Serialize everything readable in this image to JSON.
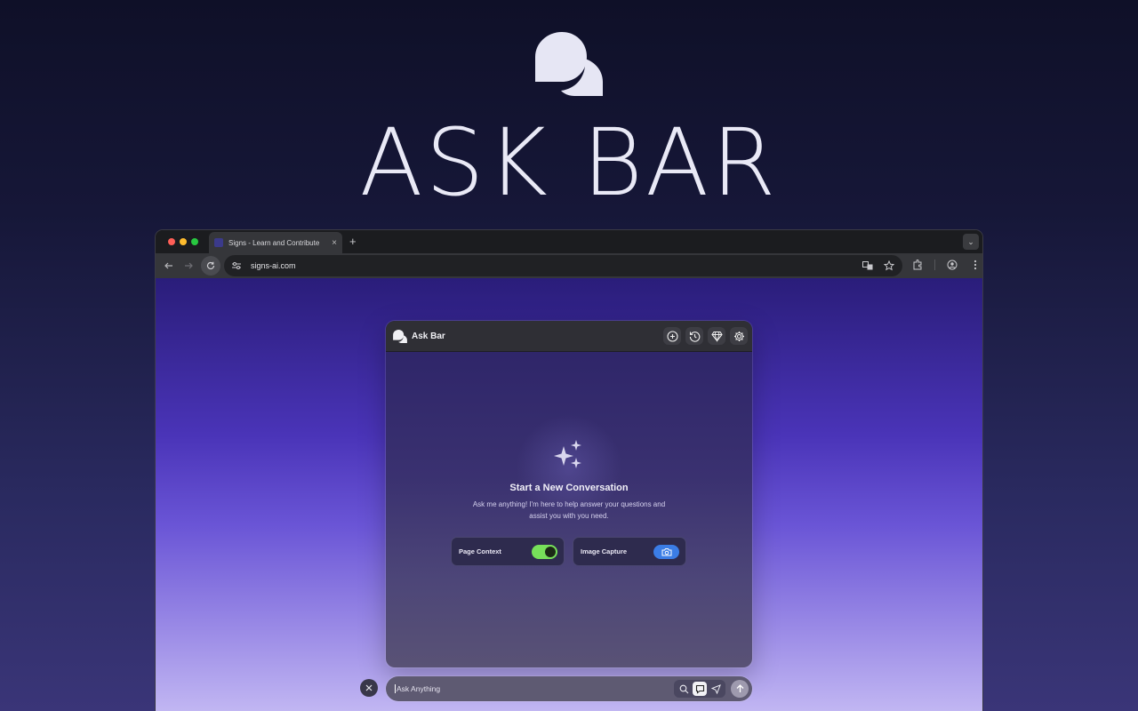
{
  "hero": {
    "title": "ASK BAR",
    "logo_icon": "chat-bubbles-icon"
  },
  "browser": {
    "tab": {
      "title": "Signs - Learn and Contribute",
      "close": "×"
    },
    "new_tab": "+",
    "url": "signs-ai.com"
  },
  "panel": {
    "title": "Ask Bar",
    "actions": [
      "plus-circle-icon",
      "history-icon",
      "gem-icon",
      "settings-icon"
    ],
    "empty_state": {
      "heading": "Start a New Conversation",
      "description": "Ask me anything! I'm here to help answer your questions and assist you with you need."
    },
    "cards": {
      "page_context": {
        "label": "Page Context",
        "enabled": true
      },
      "image_capture": {
        "label": "Image Capture"
      }
    }
  },
  "ask_input": {
    "placeholder": "Ask Anything",
    "modes": [
      "search-icon",
      "chat-icon",
      "send-arrow-icon"
    ],
    "active_mode": "chat-icon"
  },
  "colors": {
    "toggle_on": "#77e05a",
    "camera_button": "#3b7de6",
    "page_gradient_top": "#2a1d7a",
    "page_gradient_bottom": "#c9bff5"
  }
}
